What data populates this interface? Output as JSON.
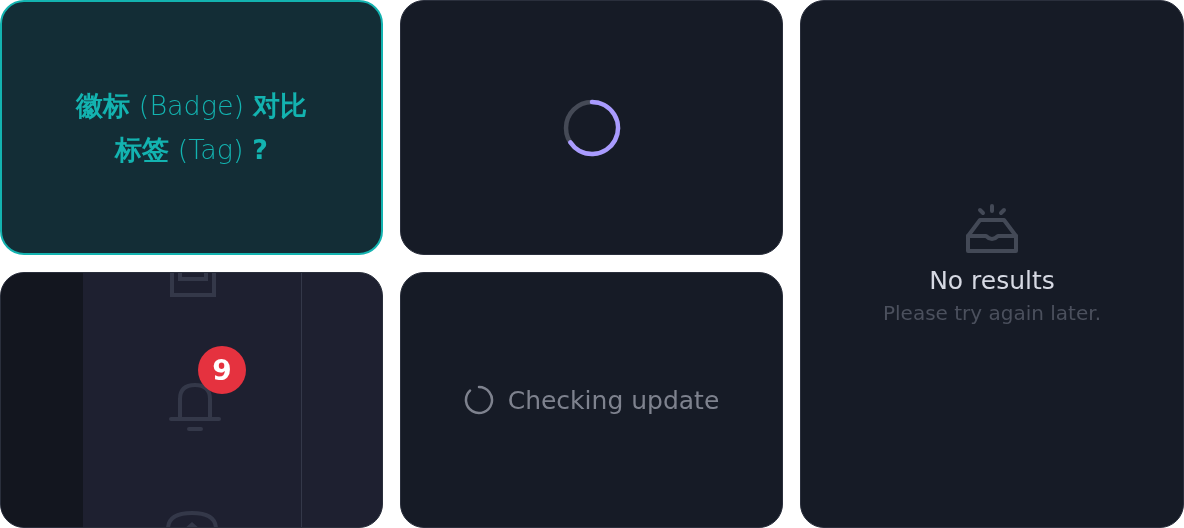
{
  "question_card": {
    "title": "**徽标** (Badge) **对比标签** (Tag) **?**"
  },
  "notification_card": {
    "badge": "9"
  },
  "update_card": {
    "status": "Checking update"
  },
  "empty_card": {
    "title": "No results",
    "message": "Please try again later."
  }
}
